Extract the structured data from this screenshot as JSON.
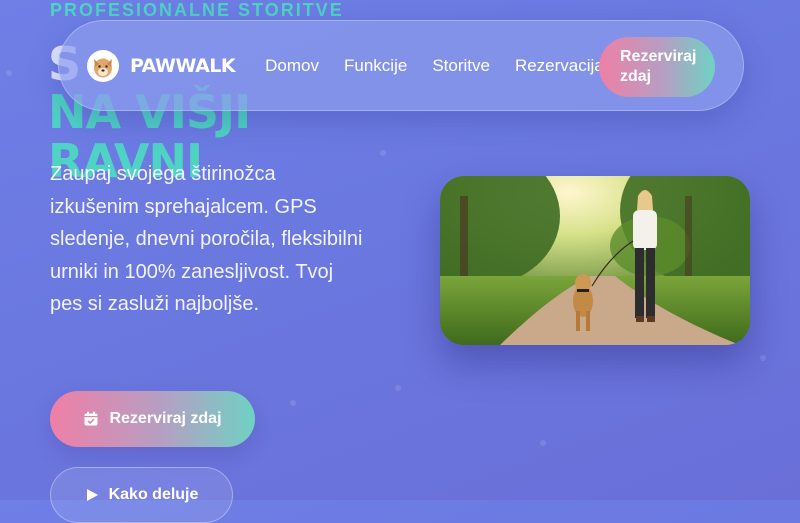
{
  "hero": {
    "eyebrow": "PROFESIONALNE STORITVE",
    "title_line1": "S",
    "title_line2": "NA VIŠJI RAVNI",
    "lead": "Zaupaj svojega štirinožca izkušenim sprehajalcem. GPS sledenje, dnevni poročila, fleksibilni urniki in 100% zanesljivost. Tvoj pes si zasluži najboljše.",
    "primary_button": "Rezerviraj zdaj",
    "secondary_button": "Kako deluje"
  },
  "nav": {
    "brand": "PAWWALK",
    "links": [
      "Domov",
      "Funkcije",
      "Storitve",
      "Rezervacija"
    ],
    "cta_line1": "Rezerviraj",
    "cta_line2": "zdaj"
  },
  "colors": {
    "background": "#6f7fe6",
    "accent_teal": "#4fd3c4",
    "accent_pink": "#ef7fa6"
  },
  "icons": {
    "logo": "dog-face-icon",
    "primary_button": "calendar-check-icon",
    "secondary_button": "play-icon"
  }
}
